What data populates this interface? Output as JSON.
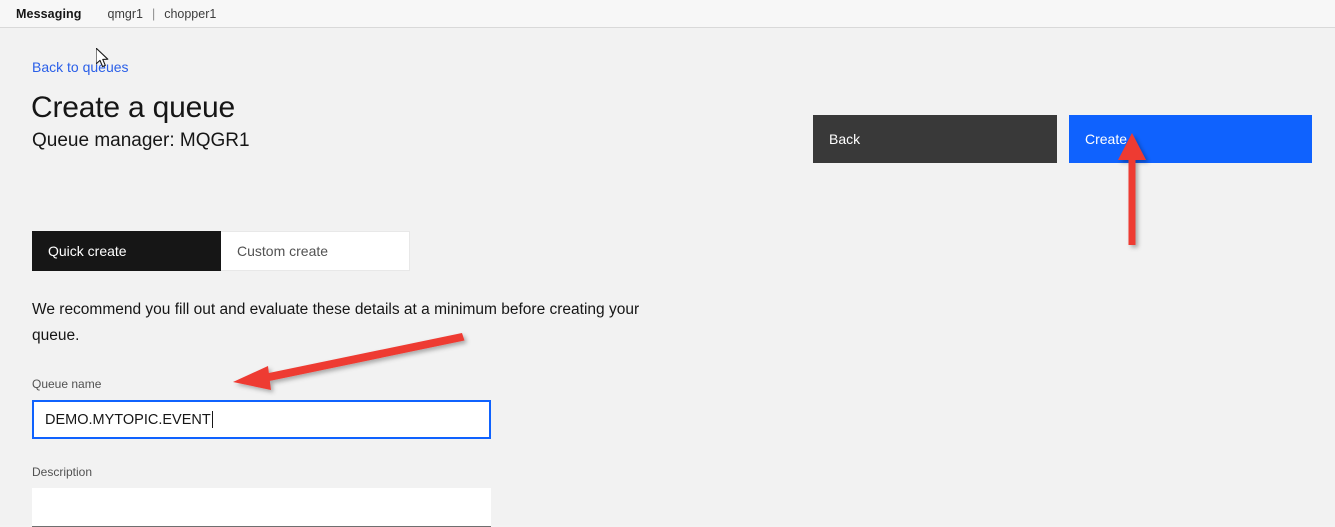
{
  "topbar": {
    "brand": "Messaging",
    "breadcrumb": [
      "qmgr1",
      "chopper1"
    ],
    "separator": "|"
  },
  "page": {
    "back_link": "Back to queues",
    "title": "Create a queue",
    "subtitle": "Queue manager: MQGR1"
  },
  "actions": {
    "back_label": "Back",
    "create_label": "Create"
  },
  "tabs": [
    {
      "label": "Quick create",
      "active": true
    },
    {
      "label": "Custom create",
      "active": false
    }
  ],
  "body": {
    "recommendation": "We recommend you fill out and evaluate these details at a minimum before creating your queue."
  },
  "form": {
    "queue_name": {
      "label": "Queue name",
      "value": "DEMO.MYTOPIC.EVENT",
      "placeholder": ""
    },
    "description": {
      "label": "Description",
      "value": "",
      "placeholder": ""
    }
  },
  "annotations": {
    "arrow_to_create_button": "red-arrow-up-icon",
    "arrow_to_queue_name_input": "red-arrow-diagonal-icon",
    "cursor": "mouse-pointer-icon"
  },
  "colors": {
    "accent_blue": "#0f62fe",
    "link_blue": "#2a5fe8",
    "dark_button": "#393939",
    "tab_active": "#161616",
    "annotation_red": "#ee3b33",
    "page_background": "#f2f2f2",
    "field_background": "#ffffff"
  }
}
